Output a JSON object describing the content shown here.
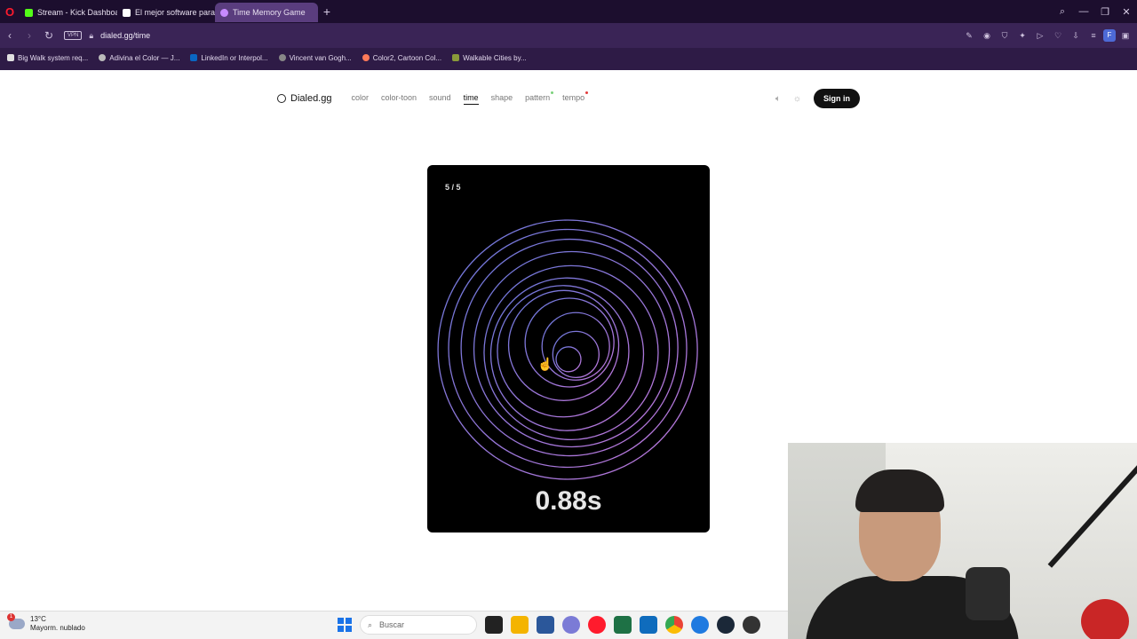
{
  "browser": {
    "tabs": [
      {
        "label": "Stream - Kick Dashboard",
        "color": "#53fc18"
      },
      {
        "label": "El mejor software para pe",
        "color": "#ffffff"
      },
      {
        "label": "Time Memory Game",
        "color": "#c78bff",
        "active": true
      }
    ],
    "url": "dialed.gg/time",
    "vpn_label": "VPN",
    "profile_initial": "F",
    "bookmarks": [
      {
        "label": "Big Walk system req...",
        "color": "#e0e0e0"
      },
      {
        "label": "Adivina el Color — J...",
        "color": "#bbbbbb"
      },
      {
        "label": "LinkedIn or Interpol...",
        "color": "#0a66c2"
      },
      {
        "label": "Vincent van Gogh...",
        "color": "#888888"
      },
      {
        "label": "Color2, Cartoon Col...",
        "color": "#ff7a59"
      },
      {
        "label": "Walkable Cities by...",
        "color": "#8a9a3a"
      }
    ]
  },
  "site": {
    "brand": "Dialed.gg",
    "nav": [
      "color",
      "color-toon",
      "sound",
      "time",
      "shape",
      "pattern",
      "tempo"
    ],
    "active_nav": "time",
    "signin_label": "Sign in"
  },
  "game": {
    "round": "5 / 5",
    "time_display": "0.88s"
  },
  "taskbar": {
    "weather_temp": "13°C",
    "weather_desc": "Mayorm. nublado",
    "weather_badge": "1",
    "search_placeholder": "Buscar"
  },
  "colors": {
    "tabbar_bg": "#1c0e2e",
    "addrbar_bg": "#3a2456",
    "ring_blue": "#7b8cff",
    "ring_pink": "#e08bff"
  }
}
